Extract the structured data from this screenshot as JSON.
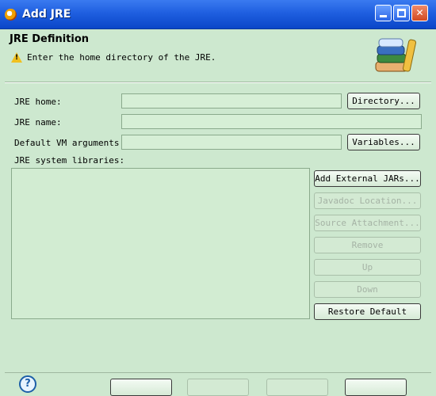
{
  "window": {
    "title": "Add JRE",
    "icon": "eclipse-icon",
    "controls": [
      "minimize-icon",
      "maximize-icon",
      "close-icon"
    ]
  },
  "header": {
    "title": "JRE Definition",
    "message": "Enter the home directory of the JRE.",
    "message_icon": "warning-icon",
    "banner_icon": "books-icon"
  },
  "form": {
    "jre_home": {
      "label": "JRE home:",
      "value": "",
      "button": "Directory..."
    },
    "jre_name": {
      "label": "JRE name:",
      "value": ""
    },
    "vm_args": {
      "label": "Default VM arguments:",
      "value": "",
      "button": "Variables..."
    },
    "libraries_label": "JRE system libraries:"
  },
  "library_buttons": [
    {
      "label": "Add External JARs...",
      "enabled": true
    },
    {
      "label": "Javadoc Location...",
      "enabled": false
    },
    {
      "label": "Source Attachment...",
      "enabled": false
    },
    {
      "label": "Remove",
      "enabled": false
    },
    {
      "label": "Up",
      "enabled": false
    },
    {
      "label": "Down",
      "enabled": false
    },
    {
      "label": "Restore Default",
      "enabled": true
    }
  ],
  "footer": {
    "help_icon": "help-icon"
  },
  "colors": {
    "background": "#cde8cf",
    "titlebar": "#1f5fe0",
    "field": "#d6efd6"
  }
}
